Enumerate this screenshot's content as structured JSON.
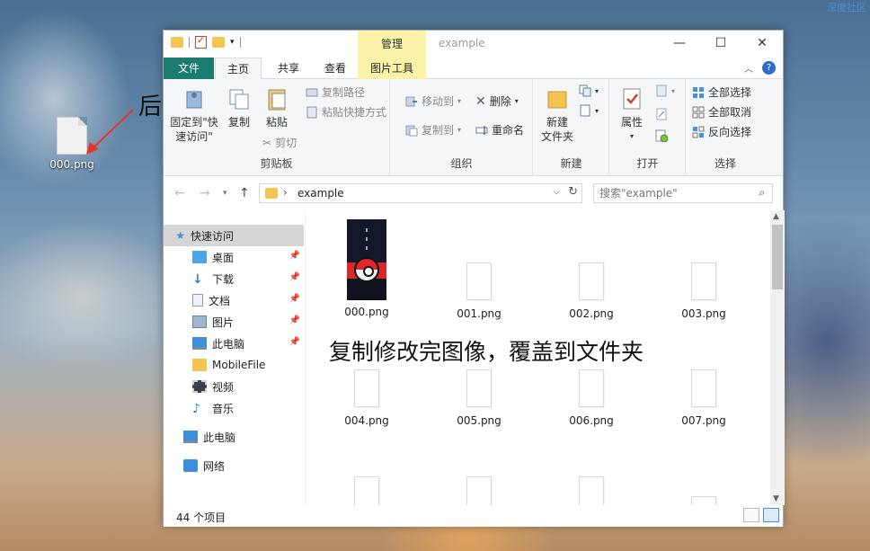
{
  "desktop": {
    "watermark": "深度社区",
    "file_label": "000.png",
    "annotation_suffix": "后缀记得修改",
    "annotation_copy": "复制修改完图像，覆盖到文件夹"
  },
  "window": {
    "title": "example",
    "context_tab": "管理",
    "controls": {
      "minimize": "—",
      "maximize": "☐",
      "close": "✕"
    }
  },
  "tabs": {
    "file": "文件",
    "home": "主页",
    "share": "共享",
    "view": "查看",
    "picture_tools": "图片工具"
  },
  "ribbon": {
    "clipboard": {
      "pin_line1": "固定到\"快",
      "pin_line2": "速访问\"",
      "copy": "复制",
      "paste": "粘贴",
      "copy_path": "复制路径",
      "paste_shortcut": "粘贴快捷方式",
      "cut": "剪切",
      "group_name": "剪贴板"
    },
    "organize": {
      "move_to": "移动到",
      "copy_to": "复制到",
      "delete": "删除",
      "rename": "重命名",
      "group_name": "组织"
    },
    "new": {
      "new_folder_line1": "新建",
      "new_folder_line2": "文件夹",
      "group_name": "新建"
    },
    "open": {
      "properties": "属性",
      "group_name": "打开"
    },
    "select": {
      "select_all": "全部选择",
      "select_none": "全部取消",
      "invert": "反向选择",
      "group_name": "选择"
    }
  },
  "address": {
    "crumb": "example",
    "search_placeholder": "搜索\"example\""
  },
  "nav": {
    "quick_access": "快速访问",
    "desktop": "桌面",
    "downloads": "下载",
    "documents": "文档",
    "pictures": "图片",
    "this_pc_pinned": "此电脑",
    "mobilefile": "MobileFile",
    "videos": "视频",
    "music": "音乐",
    "this_pc": "此电脑",
    "network": "网络"
  },
  "files": [
    "000.png",
    "001.png",
    "002.png",
    "003.png",
    "004.png",
    "005.png",
    "006.png",
    "007.png"
  ],
  "status": {
    "count": "44 个项目"
  }
}
